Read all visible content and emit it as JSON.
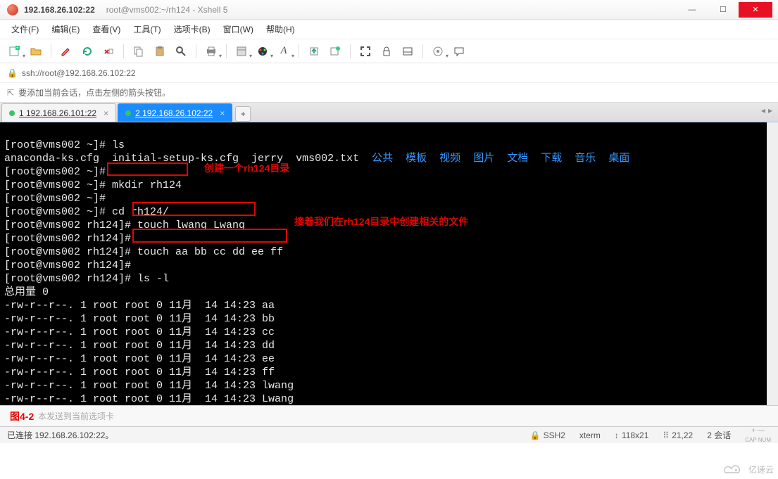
{
  "titlebar": {
    "ip": "192.168.26.102:22",
    "session": "root@vms002:~/rh124 - Xshell 5"
  },
  "menu": {
    "file": "文件(F)",
    "edit": "编辑(E)",
    "view": "查看(V)",
    "tools": "工具(T)",
    "tabs": "选项卡(B)",
    "window": "窗口(W)",
    "help": "帮助(H)"
  },
  "address": {
    "url": "ssh://root@192.168.26.102:22"
  },
  "hint": {
    "text": "要添加当前会话，点击左侧的箭头按钮。"
  },
  "tabs": {
    "t1": "1 192.168.26.101:22",
    "t2": "2 192.168.26.102:22",
    "add": "+"
  },
  "terminal": {
    "p1": "[root@vms002 ~]# ",
    "ls": "ls",
    "files_plain": "anaconda-ks.cfg  initial-setup-ks.cfg  jerry  vms002.txt  ",
    "dirs": [
      "公共",
      "模板",
      "视频",
      "图片",
      "文档",
      "下载",
      "音乐",
      "桌面"
    ],
    "p2": "[root@vms002 ~]#",
    "mkdir": "mkdir rh124",
    "cd": "cd rh124/",
    "p3": "[root@vms002 rh124]# ",
    "touch1": "touch lwang Lwang",
    "touch2": "touch aa bb cc dd ee ff",
    "lsl": "ls -l",
    "total": "总用量 0",
    "rows": [
      "-rw-r--r--. 1 root root 0 11月  14 14:23 aa",
      "-rw-r--r--. 1 root root 0 11月  14 14:23 bb",
      "-rw-r--r--. 1 root root 0 11月  14 14:23 cc",
      "-rw-r--r--. 1 root root 0 11月  14 14:23 dd",
      "-rw-r--r--. 1 root root 0 11月  14 14:23 ee",
      "-rw-r--r--. 1 root root 0 11月  14 14:23 ff",
      "-rw-r--r--. 1 root root 0 11月  14 14:23 lwang",
      "-rw-r--r--. 1 root root 0 11月  14 14:23 Lwang"
    ],
    "anno1": "创建一个rh124目录",
    "anno2": "接着我们在rh124目录中创建相关的文件"
  },
  "bottom": {
    "placeholder": "本发送到当前选项卡",
    "figure": "图4-2"
  },
  "status": {
    "left": "已连接 192.168.26.102:22。",
    "ssh": "SSH2",
    "term": "xterm",
    "size": "118x21",
    "pos": "21,22",
    "sessions": "2 会话",
    "wm": "亿速云"
  },
  "icons": {
    "sizearrow": "↕",
    "lock": "🔒",
    "capnum": "⇪",
    "plusminus": "+ -"
  }
}
